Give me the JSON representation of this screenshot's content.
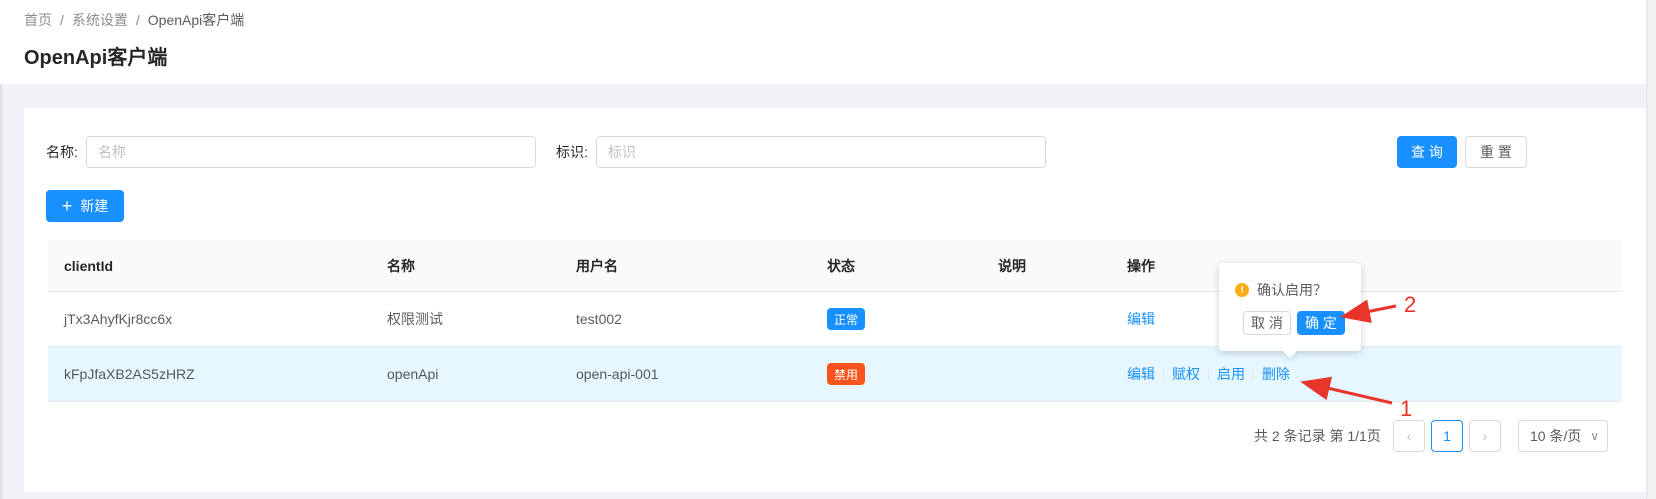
{
  "breadcrumb": [
    "首页",
    "系统设置",
    "OpenApi客户端"
  ],
  "page_title": "OpenApi客户端",
  "search": {
    "name_label": "名称:",
    "name_placeholder": "名称",
    "id_label": "标识:",
    "id_placeholder": "标识",
    "query_button": "查 询",
    "reset_button": "重 置"
  },
  "new_button": "新建",
  "table": {
    "columns": [
      "clientId",
      "名称",
      "用户名",
      "状态",
      "说明",
      "操作"
    ],
    "rows": [
      {
        "clientId": "jTx3AhyfKjr8cc6x",
        "name": "权限测试",
        "username": "test002",
        "status": "正常",
        "status_color": "#1890ff",
        "description": "",
        "actions": [
          "编辑"
        ]
      },
      {
        "clientId": "kFpJfaXB2AS5zHRZ",
        "name": "openApi",
        "username": "open-api-001",
        "status": "禁用",
        "status_color": "#fa541c",
        "description": "",
        "actions": [
          "编辑",
          "赋权",
          "启用",
          "删除"
        ]
      }
    ]
  },
  "popconfirm": {
    "message": "确认启用？",
    "cancel": "取 消",
    "ok": "确 定",
    "icon": "exclamation-circle-icon"
  },
  "pagination": {
    "total_text": "共 2 条记录 第 1/1页",
    "current_page": "1",
    "page_size": "10 条/页"
  },
  "annotations": [
    "1",
    "2"
  ],
  "colors": {
    "primary": "#1890ff",
    "annotation": "#e8352b",
    "row_highlight": "#e6f7ff"
  }
}
